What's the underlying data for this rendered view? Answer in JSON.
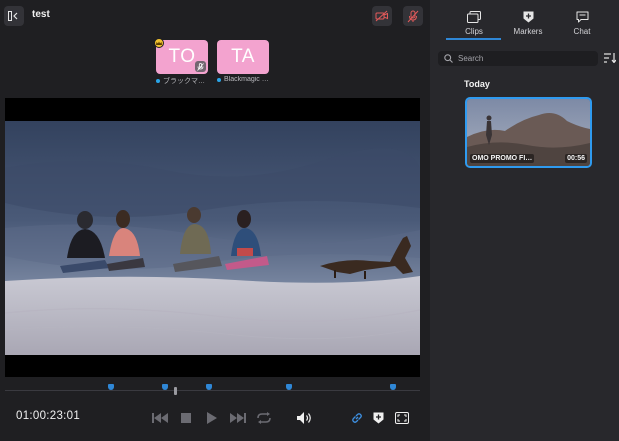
{
  "header": {
    "title": "test"
  },
  "participants": [
    {
      "initials": "TO",
      "name": "ブラックマ…",
      "is_host": true,
      "mic_muted": true
    },
    {
      "initials": "TA",
      "name": "Blackmagic …",
      "is_host": false,
      "mic_muted": false
    }
  ],
  "player": {
    "timecode": "01:00:23:01",
    "timeline_markers": [
      0.255,
      0.385,
      0.492,
      0.685,
      0.935
    ],
    "playhead": 0.41
  },
  "sidebar": {
    "tabs": [
      {
        "label": "Clips",
        "icon": "clips-icon",
        "active": true
      },
      {
        "label": "Markers",
        "icon": "marker-icon",
        "active": false
      },
      {
        "label": "Chat",
        "icon": "chat-icon",
        "active": false
      }
    ],
    "search": {
      "placeholder": "Search",
      "value": ""
    },
    "group_title": "Today",
    "clips": [
      {
        "name": "OMO PROMO FI…",
        "duration": "00:56"
      }
    ]
  },
  "colors": {
    "accent": "#2f87d6",
    "tile": "#f3a3cf",
    "presence": "#2aa5e8"
  }
}
